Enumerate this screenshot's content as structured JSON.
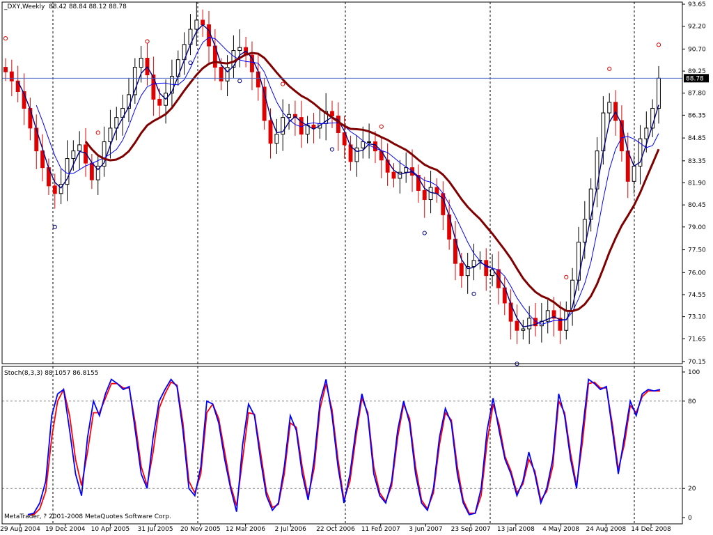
{
  "header": {
    "symbol": "_DXY,Weekly",
    "ohlc": "88.42 88.84 88.12 88.78"
  },
  "indicator": {
    "label": "Stoch(8,3,3)",
    "values": "88.1057 86.8155"
  },
  "footer": {
    "copyright": "MetaTrader, ? 2001-2008 MetaQuotes Software Corp."
  },
  "colors": {
    "bull": "#000000",
    "bear": "#e00000",
    "ma_fast": "#000080",
    "ma_mid": "#0000ff",
    "ma_slow": "#800000",
    "stoch_main": "#0000ff",
    "stoch_signal": "#ff0000",
    "price_line": "#4060c0",
    "grid": "#000000"
  },
  "chart_data": [
    {
      "type": "candlestick",
      "title": "_DXY,Weekly",
      "current_price": 88.78,
      "y_ticks": [
        93.65,
        92.2,
        90.7,
        89.25,
        87.8,
        86.35,
        84.85,
        83.35,
        81.9,
        80.45,
        79.0,
        77.5,
        76.0,
        74.55,
        73.1,
        71.65,
        70.15
      ],
      "ylim": [
        70.15,
        93.65
      ],
      "x_ticks": [
        "29 Aug 2004",
        "19 Dec 2004",
        "10 Apr 2005",
        "31 Jul 2005",
        "20 Nov 2005",
        "12 Mar 2006",
        "2 Jul 2006",
        "22 Oct 2006",
        "11 Feb 2007",
        "3 Jun 2007",
        "23 Sep 2007",
        "13 Jan 2008",
        "4 May 2008",
        "24 Aug 2008",
        "14 Dec 2008"
      ],
      "series": [
        {
          "kind": "close_path",
          "values": [
            89.2,
            88.6,
            87.9,
            86.8,
            85.5,
            84.0,
            82.9,
            81.7,
            81.2,
            81.8,
            83.5,
            84.0,
            84.4,
            83.2,
            82.1,
            83.0,
            84.6,
            85.5,
            86.2,
            86.8,
            87.7,
            89.5,
            90.1,
            89.0,
            87.4,
            87.0,
            87.8,
            88.9,
            90.0,
            91.0,
            92.0,
            92.6,
            92.3,
            90.9,
            89.5,
            88.6,
            89.5,
            90.6,
            90.8,
            90.3,
            89.2,
            88.2,
            86.0,
            84.5,
            85.1,
            86.2,
            86.4,
            86.2,
            85.1,
            85.7,
            85.5,
            85.8,
            86.6,
            86.3,
            85.2,
            84.4,
            83.3,
            84.2,
            84.6,
            84.6,
            84.0,
            83.4,
            82.6,
            82.2,
            82.6,
            82.9,
            82.4,
            81.4,
            80.8,
            81.6,
            81.2,
            79.8,
            78.2,
            76.6,
            75.8,
            76.4,
            76.8,
            76.8,
            75.8,
            76.2,
            75.0,
            74.0,
            72.8,
            72.2,
            72.3,
            73.0,
            72.5,
            72.8,
            73.5,
            73.0,
            72.2,
            73.5,
            75.5,
            78.0,
            79.5,
            81.5,
            84.0,
            86.5,
            87.2,
            86.0,
            84.0,
            82.0,
            83.0,
            84.8,
            85.5,
            86.8,
            88.78
          ]
        },
        {
          "name": "",
          "kind": "ma_fast_smoothing",
          "period": 3
        },
        {
          "name": "",
          "kind": "ma_mid_smoothing",
          "period": 6
        },
        {
          "name": "",
          "kind": "ma_slow_smoothing",
          "period": 14
        }
      ],
      "fractal_markers": [
        {
          "x": "29 Aug 2004",
          "dir": "up"
        },
        {
          "x": "19 Dec 2004",
          "dir": "down"
        },
        {
          "x": "10 Apr 2005",
          "dir": "up"
        },
        {
          "x": "31 Jul 2005",
          "dir": "up"
        },
        {
          "x": "20 Nov 2005",
          "dir": "down"
        },
        {
          "x": "12 Mar 2006",
          "dir": "down"
        },
        {
          "x": "2 Jul 2006",
          "dir": "up"
        },
        {
          "x": "22 Oct 2006",
          "dir": "down"
        },
        {
          "x": "11 Feb 2007",
          "dir": "up"
        },
        {
          "x": "3 Jun 2007",
          "dir": "down"
        },
        {
          "x": "23 Sep 2007",
          "dir": "down"
        },
        {
          "x": "13 Jan 2008",
          "dir": "down"
        },
        {
          "x": "4 May 2008",
          "dir": "up"
        },
        {
          "x": "24 Aug 2008",
          "dir": "up"
        },
        {
          "x": "14 Dec 2008",
          "dir": "up"
        }
      ]
    },
    {
      "type": "line",
      "title": "Stoch(8,3,3)",
      "ylim": [
        0,
        100
      ],
      "y_ticks": [
        100,
        80,
        20,
        0
      ],
      "levels": [
        80,
        20
      ],
      "series": [
        {
          "name": "",
          "values": [
            2,
            3,
            10,
            25,
            70,
            85,
            88,
            60,
            30,
            15,
            55,
            80,
            70,
            85,
            95,
            92,
            88,
            90,
            60,
            30,
            20,
            55,
            80,
            88,
            95,
            90,
            60,
            20,
            15,
            35,
            80,
            78,
            65,
            40,
            20,
            4,
            50,
            78,
            70,
            40,
            15,
            5,
            10,
            35,
            70,
            60,
            30,
            12,
            40,
            80,
            95,
            70,
            35,
            10,
            30,
            60,
            85,
            70,
            30,
            15,
            10,
            25,
            60,
            80,
            65,
            30,
            10,
            5,
            20,
            55,
            75,
            65,
            30,
            10,
            2,
            3,
            20,
            60,
            82,
            60,
            40,
            30,
            15,
            25,
            45,
            30,
            10,
            20,
            40,
            85,
            70,
            40,
            20,
            60,
            95,
            92,
            88,
            90,
            60,
            30,
            55,
            80,
            70,
            85,
            88,
            87,
            88
          ]
        },
        {
          "name": "",
          "values": [
            2,
            2,
            6,
            18,
            55,
            80,
            88,
            70,
            40,
            22,
            45,
            72,
            72,
            82,
            92,
            92,
            89,
            89,
            65,
            35,
            22,
            45,
            75,
            85,
            93,
            91,
            65,
            25,
            17,
            30,
            72,
            78,
            68,
            45,
            22,
            8,
            40,
            72,
            71,
            45,
            18,
            7,
            9,
            30,
            65,
            62,
            35,
            14,
            34,
            75,
            92,
            74,
            40,
            12,
            25,
            55,
            82,
            72,
            35,
            17,
            11,
            22,
            55,
            78,
            68,
            35,
            12,
            6,
            17,
            50,
            72,
            67,
            35,
            12,
            3,
            3,
            15,
            52,
            78,
            64,
            42,
            32,
            17,
            23,
            40,
            32,
            12,
            18,
            35,
            80,
            72,
            44,
            22,
            52,
            92,
            93,
            89,
            89,
            64,
            33,
            50,
            77,
            72,
            83,
            87,
            87,
            87
          ]
        }
      ]
    }
  ]
}
